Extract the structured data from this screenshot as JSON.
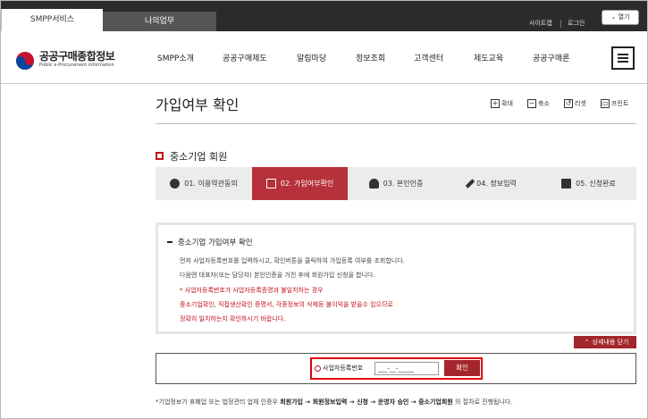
{
  "topbar": {
    "tab_smpp": "SMPP서비스",
    "tab_mywork": "나의업무",
    "sitemap": "사이트맵",
    "login": "로그인",
    "open_label": "열기"
  },
  "logo": {
    "title": "공공구매종합정보",
    "subtitle": "Public e-Procurement information"
  },
  "nav": [
    "SMPP소개",
    "공공구매제도",
    "알림마당",
    "정보조회",
    "고객센터",
    "제도교육",
    "공공구매론"
  ],
  "page": {
    "title": "가입여부 확인",
    "tools": [
      "확대",
      "축소",
      "리셋",
      "프린트"
    ]
  },
  "section": {
    "title": "중소기업 회원"
  },
  "steps": [
    {
      "label": "01. 이용약관동의",
      "icon": "check-circle-icon",
      "active": false
    },
    {
      "label": "02. 가입여부확인",
      "icon": "monitor-icon",
      "active": true
    },
    {
      "label": "03. 본인인증",
      "icon": "person-icon",
      "active": false
    },
    {
      "label": "04. 정보입력",
      "icon": "pencil-icon",
      "active": false
    },
    {
      "label": "05. 신청완료",
      "icon": "document-check-icon",
      "active": false
    }
  ],
  "info": {
    "heading": "중소기업 가입여부 확인",
    "line1": "먼저 사업자등록번호를 입력하시고, 확인버튼을 클릭하여 가입등록 여부를 조회합니다.",
    "line2": "다음엔 대표자(또는 담당자) 본인인증을 거친 후에 회원가입 신청을 합니다.",
    "line3": "* 사업자등록번호가 사업자등록증명과 불일치하는 경우",
    "line4": "중소기업확인, 직접생산확인 증명서, 각종정보의 삭제등 불이익을 받을수 있으므로",
    "line5": "정확히 일치하는지 확인하시기 바랍니다."
  },
  "detail_button": "상세내용 닫기",
  "biz": {
    "label": "사업자등록번호",
    "input_value": "___-__-_____",
    "confirm": "확인"
  },
  "footnote": {
    "prefix": "*기업정보가 휴폐업 또는 법정관리 업체 인증우 ",
    "flow": "회원가입 → 회원정보입력 → 신청 → 운영자 승인 → 중소기업회원",
    "suffix": " 의 절차로 진행됩니다."
  },
  "colors": {
    "accent": "#b6313b",
    "highlight_box": "#e2000f",
    "topbar": "#2b2b2b"
  }
}
